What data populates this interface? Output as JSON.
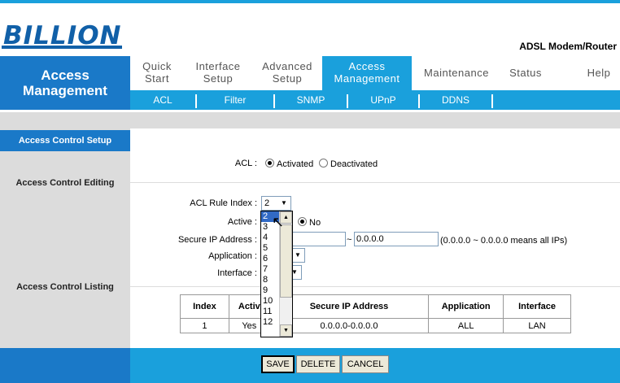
{
  "brand": {
    "logo": "BILLION",
    "product": "ADSL Modem/Router"
  },
  "header": {
    "line1": "Access",
    "line2": "Management"
  },
  "nav": [
    {
      "line1": "Quick",
      "line2": "Start"
    },
    {
      "line1": "Interface",
      "line2": "Setup"
    },
    {
      "line1": "Advanced",
      "line2": "Setup"
    },
    {
      "line1": "Access",
      "line2": "Management"
    },
    {
      "line1": "Maintenance",
      "line2": ""
    },
    {
      "line1": "Status",
      "line2": ""
    },
    {
      "line1": "Help",
      "line2": ""
    }
  ],
  "subnav": [
    "ACL",
    "Filter",
    "SNMP",
    "UPnP",
    "DDNS"
  ],
  "section": {
    "title": "Access Control Setup",
    "editing": "Access Control Editing",
    "listing": "Access Control Listing"
  },
  "form": {
    "acl_label": "ACL :",
    "acl_activated": "Activated",
    "acl_deactivated": "Deactivated",
    "rule_index_label": "ACL Rule Index :",
    "rule_index_value": "2",
    "active_label": "Active :",
    "active_no": "No",
    "secure_ip_label": "Secure IP Address :",
    "secure_ip_end": "0.0.0.0",
    "secure_ip_tilde": "~",
    "secure_ip_hint": "(0.0.0.0 ~ 0.0.0.0 means all IPs)",
    "application_label": "Application :",
    "interface_label": "Interface :"
  },
  "dropdown": {
    "options": [
      "2",
      "3",
      "4",
      "5",
      "6",
      "7",
      "8",
      "9",
      "10",
      "11",
      "12"
    ],
    "selected": "2"
  },
  "table": {
    "headers": [
      "Index",
      "Active",
      "Secure IP Address",
      "Application",
      "Interface"
    ],
    "header_visible": [
      "Index",
      "Activ",
      "Secure IP Address",
      "Application",
      "Interface"
    ],
    "rows": [
      {
        "index": "1",
        "active": "Yes",
        "active_visible": "Yes",
        "ip": "0.0.0.0-0.0.0.0",
        "application": "ALL",
        "interface": "LAN"
      }
    ]
  },
  "buttons": {
    "save": "SAVE",
    "delete": "DELETE",
    "cancel": "CANCEL"
  },
  "colors": {
    "primary": "#1a79c8",
    "accent": "#1aa0dc",
    "grey": "#dcdcdc"
  }
}
